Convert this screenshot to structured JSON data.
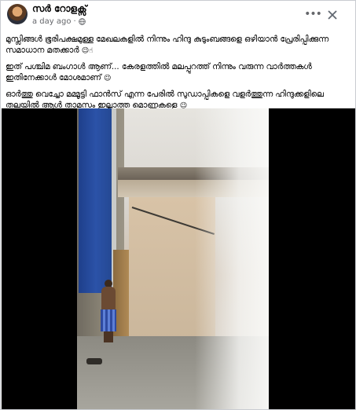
{
  "post": {
    "author": "സർ റോളക്സ്",
    "time": "a day ago",
    "separator": "·",
    "more_label": "•••",
    "paragraphs": [
      {
        "text": "മുസ്ലിങ്ങൾ ഭൂരിപക്ഷമുള്ള മേഖലകളിൽ നിന്നും ഹിന്ദു കുടുംബങ്ങളെ ഒഴിയാൻ പ്രേരിപ്പിക്കുന്ന സമാധാന മതക്കാർ",
        "emoji": "😉☝"
      },
      {
        "text": "ഇത് പശ്ചിമ ബംഗാൾ ആണ്... കേരളത്തിൽ മലപ്പുറത്ത് നിന്നും വരുന്ന വാർത്തകൾ ഇതിനേക്കാൾ മോശമാണ്",
        "emoji": "😉"
      },
      {
        "text": "ഓർത്തു വെച്ചോ മമ്മൂട്ടി ഫാൻസ് എന്ന പേരിൽ സുഡാപ്പികളെ വളർത്തുന്ന ഹിന്ദുക്കളിലെ തലയിൽ ആൾ താമസം ഇല്ലാത്ത മൊണ്ണകളെ",
        "emoji": "😉"
      }
    ]
  },
  "colors": {
    "text": "#050505",
    "meta": "#65676b",
    "border": "#c9ccd1",
    "video_bg": "#000000"
  },
  "icons": {
    "globe": "globe-icon",
    "more": "more-options-icon",
    "close": "close-icon"
  }
}
